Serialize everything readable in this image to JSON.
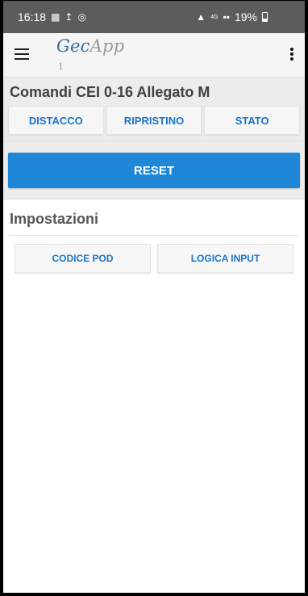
{
  "status_bar": {
    "time": "16:18",
    "left_icons": [
      "image-icon",
      "thermometer-icon",
      "sync-icon"
    ],
    "network": "4G",
    "battery": "19%"
  },
  "app_bar": {
    "title_prefix": "Gec",
    "title_suffix": "App",
    "subtitle": "1"
  },
  "commands": {
    "title": "Comandi CEI 0-16 Allegato M",
    "buttons": [
      "DISTACCO",
      "RIPRISTINO",
      "STATO"
    ],
    "reset_label": "RESET"
  },
  "settings": {
    "title": "Impostazioni",
    "buttons": [
      "CODICE POD",
      "LOGICA INPUT"
    ]
  },
  "colors": {
    "accent": "#1f87d8",
    "button_text": "#1a73c8",
    "status_bar": "#5c5c5c"
  }
}
